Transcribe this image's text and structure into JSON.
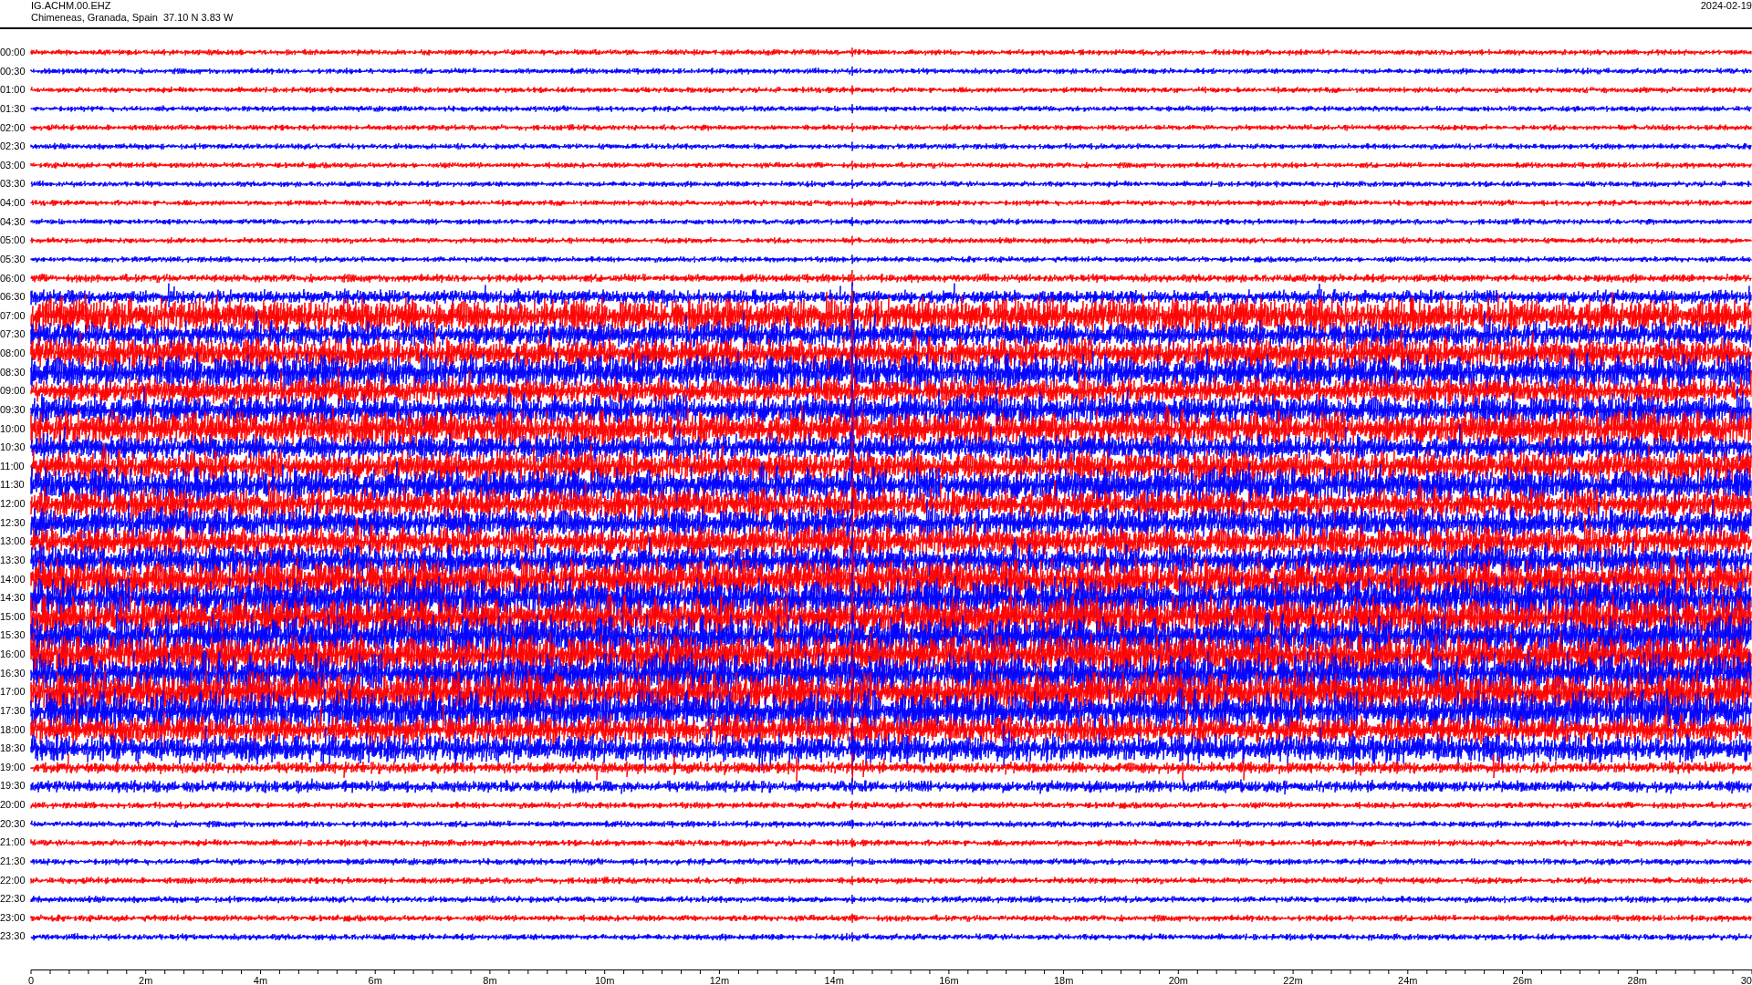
{
  "header": {
    "station": "IG.ACHM.00.EHZ",
    "location": "Chimeneas, Granada, Spain  37.10 N 3.83 W",
    "date": "2024-02-19"
  },
  "rows": [
    {
      "time": "00:00",
      "color": "#ff0000"
    },
    {
      "time": "00:30",
      "color": "#0000ff"
    },
    {
      "time": "01:00",
      "color": "#ff0000"
    },
    {
      "time": "01:30",
      "color": "#0000ff"
    },
    {
      "time": "02:00",
      "color": "#ff0000"
    },
    {
      "time": "02:30",
      "color": "#0000ff"
    },
    {
      "time": "03:00",
      "color": "#ff0000"
    },
    {
      "time": "03:30",
      "color": "#0000ff"
    },
    {
      "time": "04:00",
      "color": "#ff0000"
    },
    {
      "time": "04:30",
      "color": "#0000ff"
    },
    {
      "time": "05:00",
      "color": "#ff0000"
    },
    {
      "time": "05:30",
      "color": "#0000ff"
    },
    {
      "time": "06:00",
      "color": "#ff0000"
    },
    {
      "time": "06:30",
      "color": "#0000ff"
    },
    {
      "time": "07:00",
      "color": "#ff0000"
    },
    {
      "time": "07:30",
      "color": "#0000ff"
    },
    {
      "time": "08:00",
      "color": "#ff0000"
    },
    {
      "time": "08:30",
      "color": "#0000ff"
    },
    {
      "time": "09:00",
      "color": "#ff0000"
    },
    {
      "time": "09:30",
      "color": "#0000ff"
    },
    {
      "time": "10:00",
      "color": "#ff0000"
    },
    {
      "time": "10:30",
      "color": "#0000ff"
    },
    {
      "time": "11:00",
      "color": "#ff0000"
    },
    {
      "time": "11:30",
      "color": "#0000ff"
    },
    {
      "time": "12:00",
      "color": "#ff0000"
    },
    {
      "time": "12:30",
      "color": "#0000ff"
    },
    {
      "time": "13:00",
      "color": "#ff0000"
    },
    {
      "time": "13:30",
      "color": "#0000ff"
    },
    {
      "time": "14:00",
      "color": "#ff0000"
    },
    {
      "time": "14:30",
      "color": "#0000ff"
    },
    {
      "time": "15:00",
      "color": "#ff0000"
    },
    {
      "time": "15:30",
      "color": "#0000ff"
    },
    {
      "time": "16:00",
      "color": "#ff0000"
    },
    {
      "time": "16:30",
      "color": "#0000ff"
    },
    {
      "time": "17:00",
      "color": "#ff0000"
    },
    {
      "time": "17:30",
      "color": "#0000ff"
    },
    {
      "time": "18:00",
      "color": "#ff0000"
    },
    {
      "time": "18:30",
      "color": "#0000ff"
    },
    {
      "time": "19:00",
      "color": "#ff0000"
    },
    {
      "time": "19:30",
      "color": "#0000ff"
    },
    {
      "time": "20:00",
      "color": "#ff0000"
    },
    {
      "time": "20:30",
      "color": "#0000ff"
    },
    {
      "time": "21:00",
      "color": "#ff0000"
    },
    {
      "time": "21:30",
      "color": "#0000ff"
    },
    {
      "time": "22:00",
      "color": "#ff0000"
    },
    {
      "time": "22:30",
      "color": "#0000ff"
    },
    {
      "time": "23:00",
      "color": "#ff0000"
    },
    {
      "time": "23:30",
      "color": "#0000ff"
    }
  ],
  "x_axis": {
    "labels": [
      "0",
      "2m",
      "4m",
      "6m",
      "8m",
      "10m",
      "12m",
      "14m",
      "16m",
      "18m",
      "20m",
      "22m",
      "24m",
      "26m",
      "28m",
      "30"
    ]
  }
}
